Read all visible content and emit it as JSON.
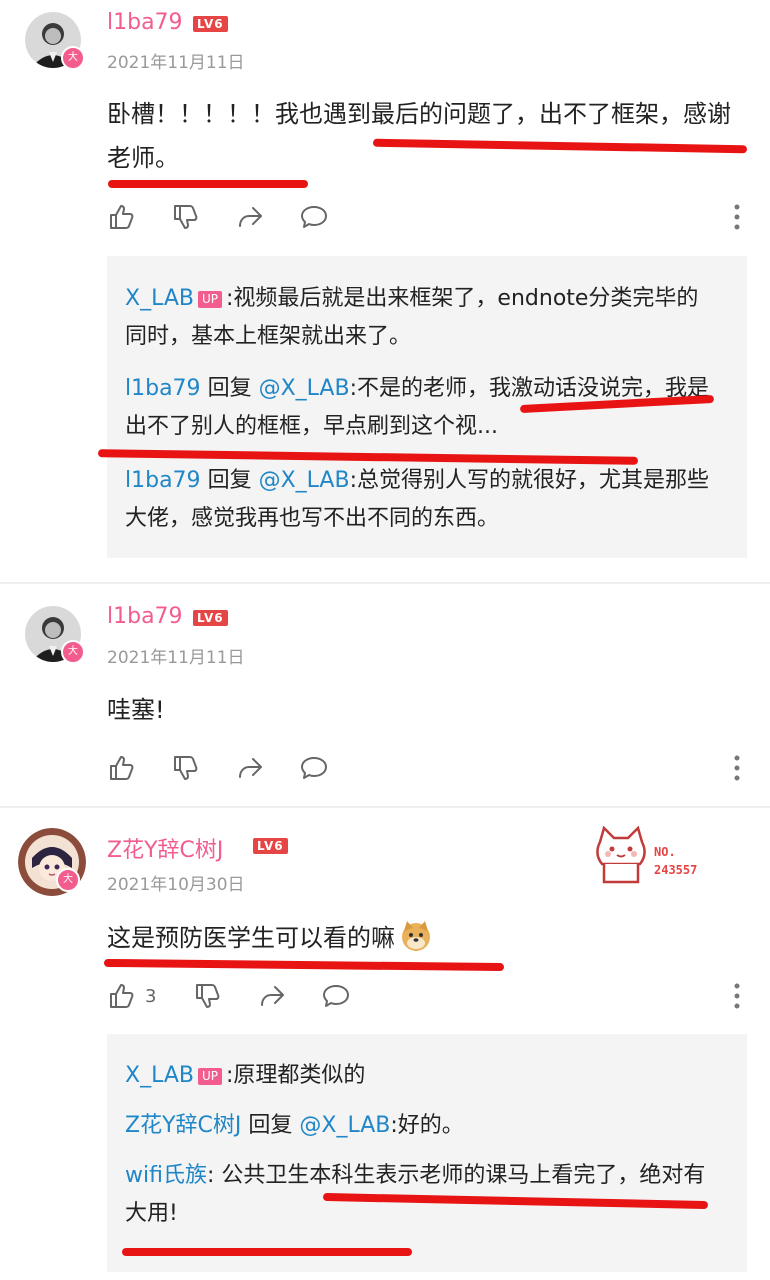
{
  "comments": [
    {
      "username": "l1ba79",
      "level": "LV6",
      "date": "2021年11月11日",
      "content": "卧槽！！！！！我也遇到最后的问题了，出不了框架，感谢老师。",
      "replies": [
        {
          "name": "X_LAB",
          "up_badge": "UP",
          "reply_word": "",
          "target": "",
          "text": ":视频最后就是出来框架了，endnote分类完毕的同时，基本上框架就出来了。"
        },
        {
          "name": "l1ba79",
          "up_badge": "",
          "reply_word": "回复",
          "target": "@X_LAB",
          "text": ":不是的老师，我激动话没说完，我是出不了别人的框框，早点刷到这个视..."
        },
        {
          "name": "l1ba79",
          "up_badge": "",
          "reply_word": "回复",
          "target": "@X_LAB",
          "text": ":总觉得别人写的就很好，尤其是那些大佬，感觉我再也写不出不同的东西。"
        }
      ]
    },
    {
      "username": "l1ba79",
      "level": "LV6",
      "date": "2021年11月11日",
      "content": "哇塞!"
    },
    {
      "username": "Z花Y辞C树J",
      "level": "LV6",
      "date": "2021年10月30日",
      "content": "这是预防医学生可以看的嘛",
      "like_count": "3",
      "medal": {
        "label": "NO.",
        "number": "243557"
      },
      "replies": [
        {
          "name": "X_LAB",
          "up_badge": "UP",
          "reply_word": "",
          "target": "",
          "text": ":原理都类似的"
        },
        {
          "name": "Z花Y辞C树J",
          "up_badge": "",
          "reply_word": "回复",
          "target": "@X_LAB",
          "text": ":好的。"
        },
        {
          "name": "wifi氏族",
          "up_badge": "",
          "reply_word": "",
          "target": "",
          "text": ": 公共卫生本科生表示老师的课马上看完了，绝对有大用!"
        }
      ]
    }
  ],
  "colors": {
    "username": "#f25d8e",
    "reply_name": "#1f86c8",
    "level_badge": "#e64545",
    "annotation": "#e81414",
    "reply_bg": "#f4f4f4"
  },
  "icons": [
    "like-icon",
    "dislike-icon",
    "share-icon",
    "comment-icon",
    "more-icon"
  ]
}
